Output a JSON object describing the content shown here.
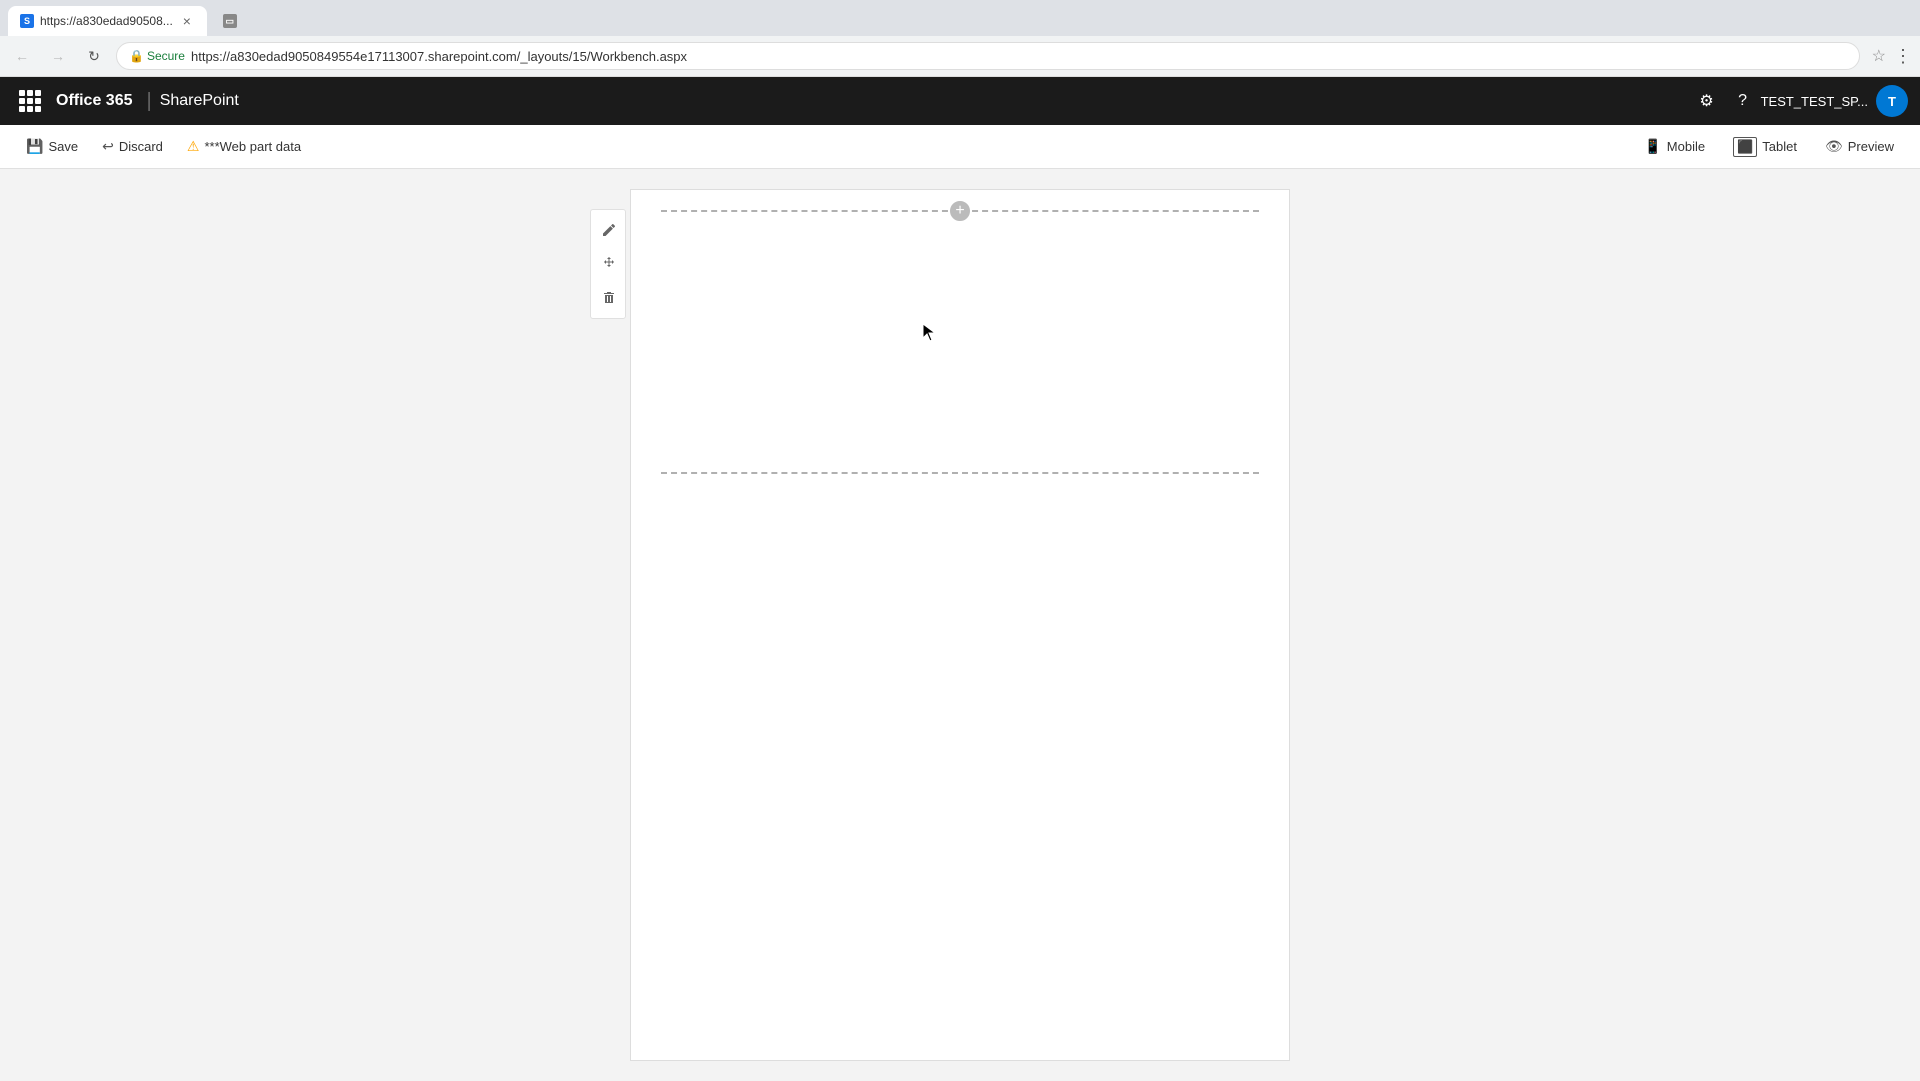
{
  "browser": {
    "tab": {
      "favicon_text": "S",
      "title": "https://a830edad90508...",
      "close_label": "×"
    },
    "tab_inactive": {
      "icon": "▭"
    },
    "address_bar": {
      "secure_label": "Secure",
      "url": "https://a830edad9050849554e17113007.sharepoint.com/_layouts/15/Workbench.aspx",
      "lock_icon": "🔒"
    },
    "nav": {
      "back": "←",
      "forward": "→",
      "refresh": "↻",
      "star": "☆",
      "more": "⋮"
    }
  },
  "header": {
    "waffle_label": "App launcher",
    "office365_label": "Office 365",
    "divider": "|",
    "sharepoint_label": "SharePoint",
    "settings_icon": "⚙",
    "help_icon": "?",
    "user_name": "TEST_TEST_SP...",
    "avatar_initials": "T"
  },
  "toolbar": {
    "save_label": "Save",
    "save_icon": "💾",
    "discard_label": "Discard",
    "discard_icon": "↩",
    "webpart_warning_label": "***Web part data",
    "warning_icon": "⚠",
    "mobile_label": "Mobile",
    "mobile_icon": "📱",
    "tablet_label": "Tablet",
    "tablet_icon": "⬜",
    "preview_label": "Preview",
    "preview_icon": "👁"
  },
  "webpart": {
    "add_btn": "+",
    "panel_icons": [
      "✏",
      "✥",
      "🗑"
    ]
  }
}
